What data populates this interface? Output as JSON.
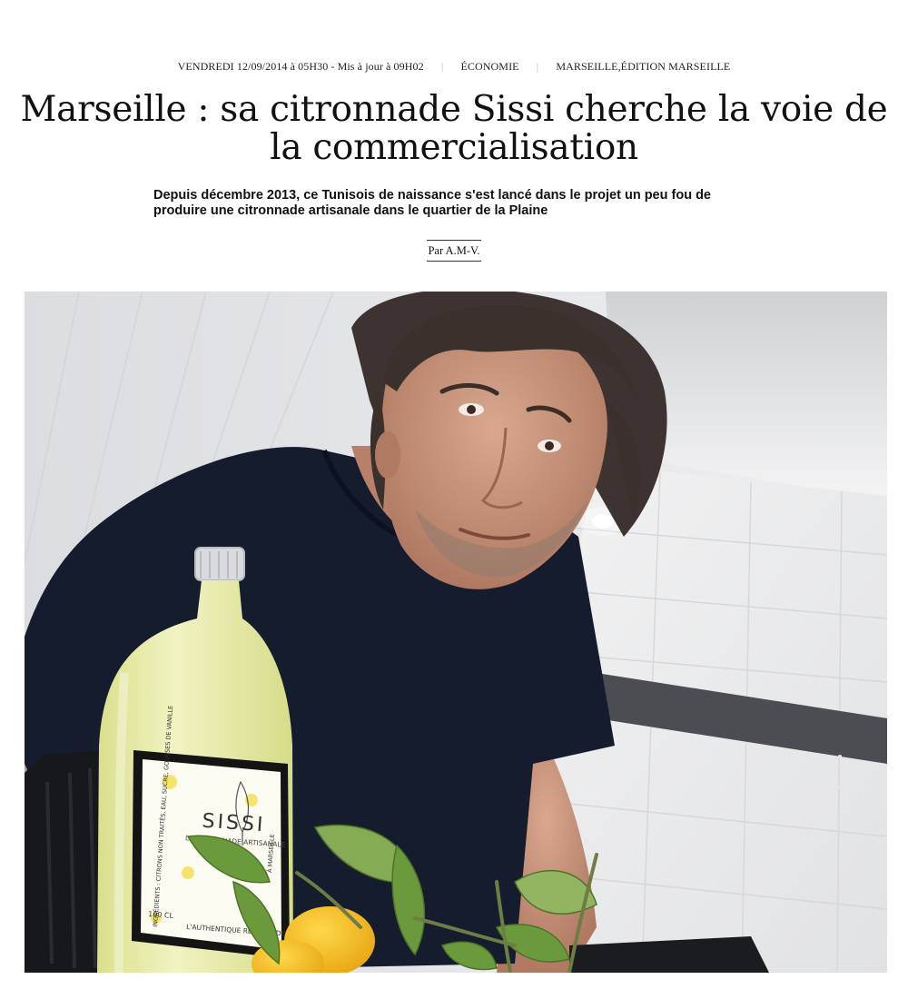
{
  "meta": {
    "date": "VENDREDI 12/09/2014 à 05H30 - Mis à jour à 09H02",
    "category": "ÉCONOMIE",
    "tags": "MARSEILLE,ÉDITION MARSEILLE"
  },
  "article": {
    "title": "Marseille : sa citronnade Sissi cherche la voie de la commercialisation",
    "chapo": "Depuis décembre 2013, ce Tunisois de naissance s'est lancé dans le projet un peu fou de produire une citronnade artisanale dans le quartier de la Plaine",
    "byline": "Par A.M-V."
  },
  "photo": {
    "bottle_label": {
      "brand": "SISSI",
      "subtitle": "LA CITRONNADE ARTISANALE",
      "ingredients": "INGRÉDIENTS : CITRONS NON TRAITÉS, EAU, SUCRE, GOUSSES DE VANILLE",
      "origin": "À MARSEILLE",
      "volume": "100 CL",
      "tagline": "L'AUTHENTIQUE RECETTE DE SISSI"
    }
  },
  "colors": {
    "text": "#111111",
    "separator": "#bbbbbb",
    "shirt": "#151c2e",
    "lemonade": "#e6eba0"
  }
}
